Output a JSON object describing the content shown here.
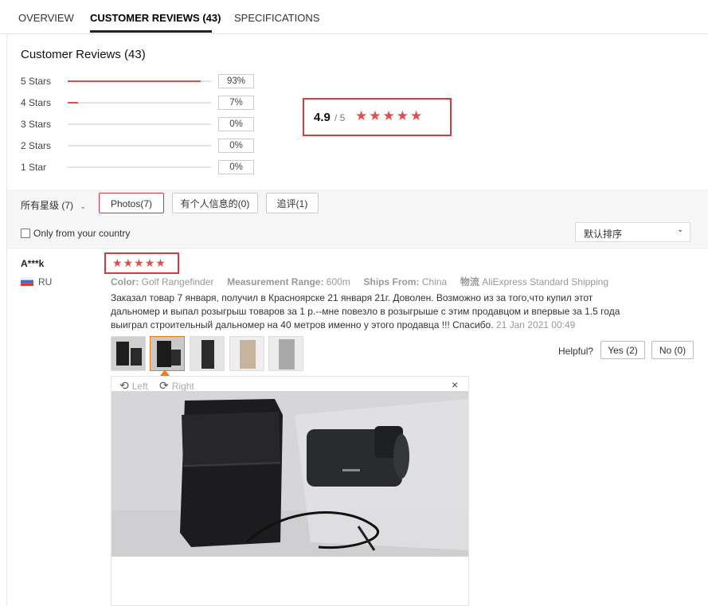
{
  "tabs": [
    {
      "label": "OVERVIEW"
    },
    {
      "label": "CUSTOMER REVIEWS (43)"
    },
    {
      "label": "SPECIFICATIONS"
    }
  ],
  "summary": {
    "title": "Customer Reviews (43)",
    "rows": [
      {
        "label": "5 Stars",
        "pct_text": "93%",
        "fraction": 0.93
      },
      {
        "label": "4 Stars",
        "pct_text": "7%",
        "fraction": 0.07
      },
      {
        "label": "3 Stars",
        "pct_text": "0%",
        "fraction": 0
      },
      {
        "label": "2 Stars",
        "pct_text": "0%",
        "fraction": 0
      },
      {
        "label": "1 Star",
        "pct_text": "0%",
        "fraction": 0
      }
    ],
    "rating_value": "4.9",
    "rating_of": "/ 5",
    "rating_stars": 5
  },
  "filters": {
    "all_label": "所有星级 (7)",
    "photos": "Photos(7)",
    "personal": "有个人信息的(0)",
    "additional": "追评(1)",
    "country_only": "Only from your country",
    "sort_label": "默认排序"
  },
  "review": {
    "name": "A***k",
    "country": "RU",
    "stars": 5,
    "color_label": "Color:",
    "color_value": "Golf Rangefinder",
    "measure_label": "Measurement Range:",
    "measure_value": "600m",
    "ships_label": "Ships From:",
    "ships_value": "China",
    "logistics_label": "物流",
    "logistics_value": "AliExpress Standard Shipping",
    "text": "Заказал товар 7 января, получил в Красноярске 21 января 21г. Доволен. Возможно из за того,что купил этот дальномер и выпал розыгрыш товаров за 1 р.--мне повезло в розыгрыше с этим продавцом и впервые за 1.5 года выиграл строительный дальномер на 40 метров именно у этого продавца !!! Спасибо.",
    "date": "21 Jan 2021 00:49",
    "helpful_label": "Helpful?",
    "yes_label": "Yes (2)",
    "no_label": "No (0)"
  },
  "viewer": {
    "left_label": "Left",
    "right_label": "Right",
    "close_symbol": "×"
  },
  "colors": {
    "accent_red": "#e84a4a",
    "border_red": "#d9383f",
    "selected_orange": "#f07c18"
  }
}
